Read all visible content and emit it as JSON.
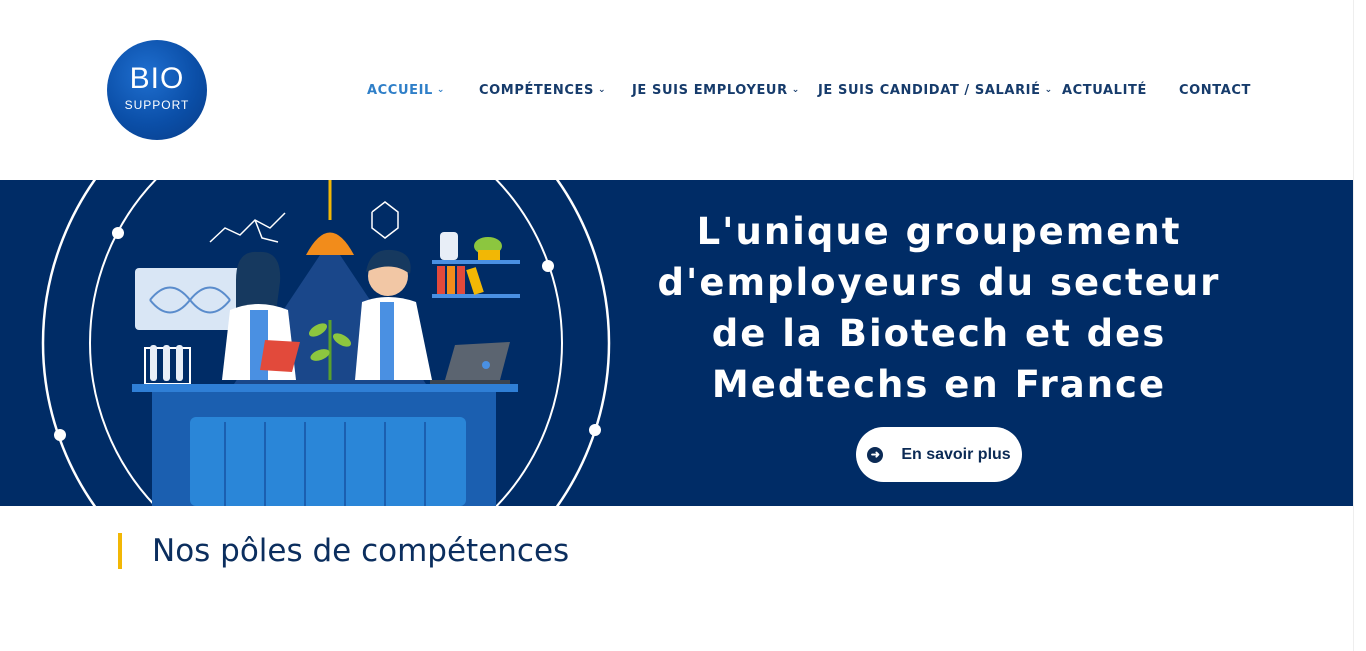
{
  "logo": {
    "main": "BIO",
    "sub": "SUPPORT"
  },
  "nav": [
    {
      "label": "ACCUEIL",
      "has_dropdown": true,
      "active": true
    },
    {
      "label": "COMPÉTENCES",
      "has_dropdown": true,
      "active": false
    },
    {
      "label": "JE SUIS EMPLOYEUR",
      "has_dropdown": true,
      "active": false
    },
    {
      "label": "JE SUIS CANDIDAT / SALARIÉ",
      "has_dropdown": true,
      "active": false
    },
    {
      "label": "ACTUALITÉ",
      "has_dropdown": false,
      "active": false
    },
    {
      "label": "CONTACT",
      "has_dropdown": false,
      "active": false
    }
  ],
  "hero": {
    "title": "L'unique groupement d'employeurs du secteur de la Biotech et des Medtechs en France",
    "cta_label": "En savoir plus",
    "cta_icon": "arrow-circle-right-icon"
  },
  "section": {
    "title": "Nos pôles de compétences"
  },
  "colors": {
    "navy": "#002c66",
    "accent": "#f2b705",
    "active_link": "#2f7fc8",
    "nav_text": "#163b6b"
  }
}
